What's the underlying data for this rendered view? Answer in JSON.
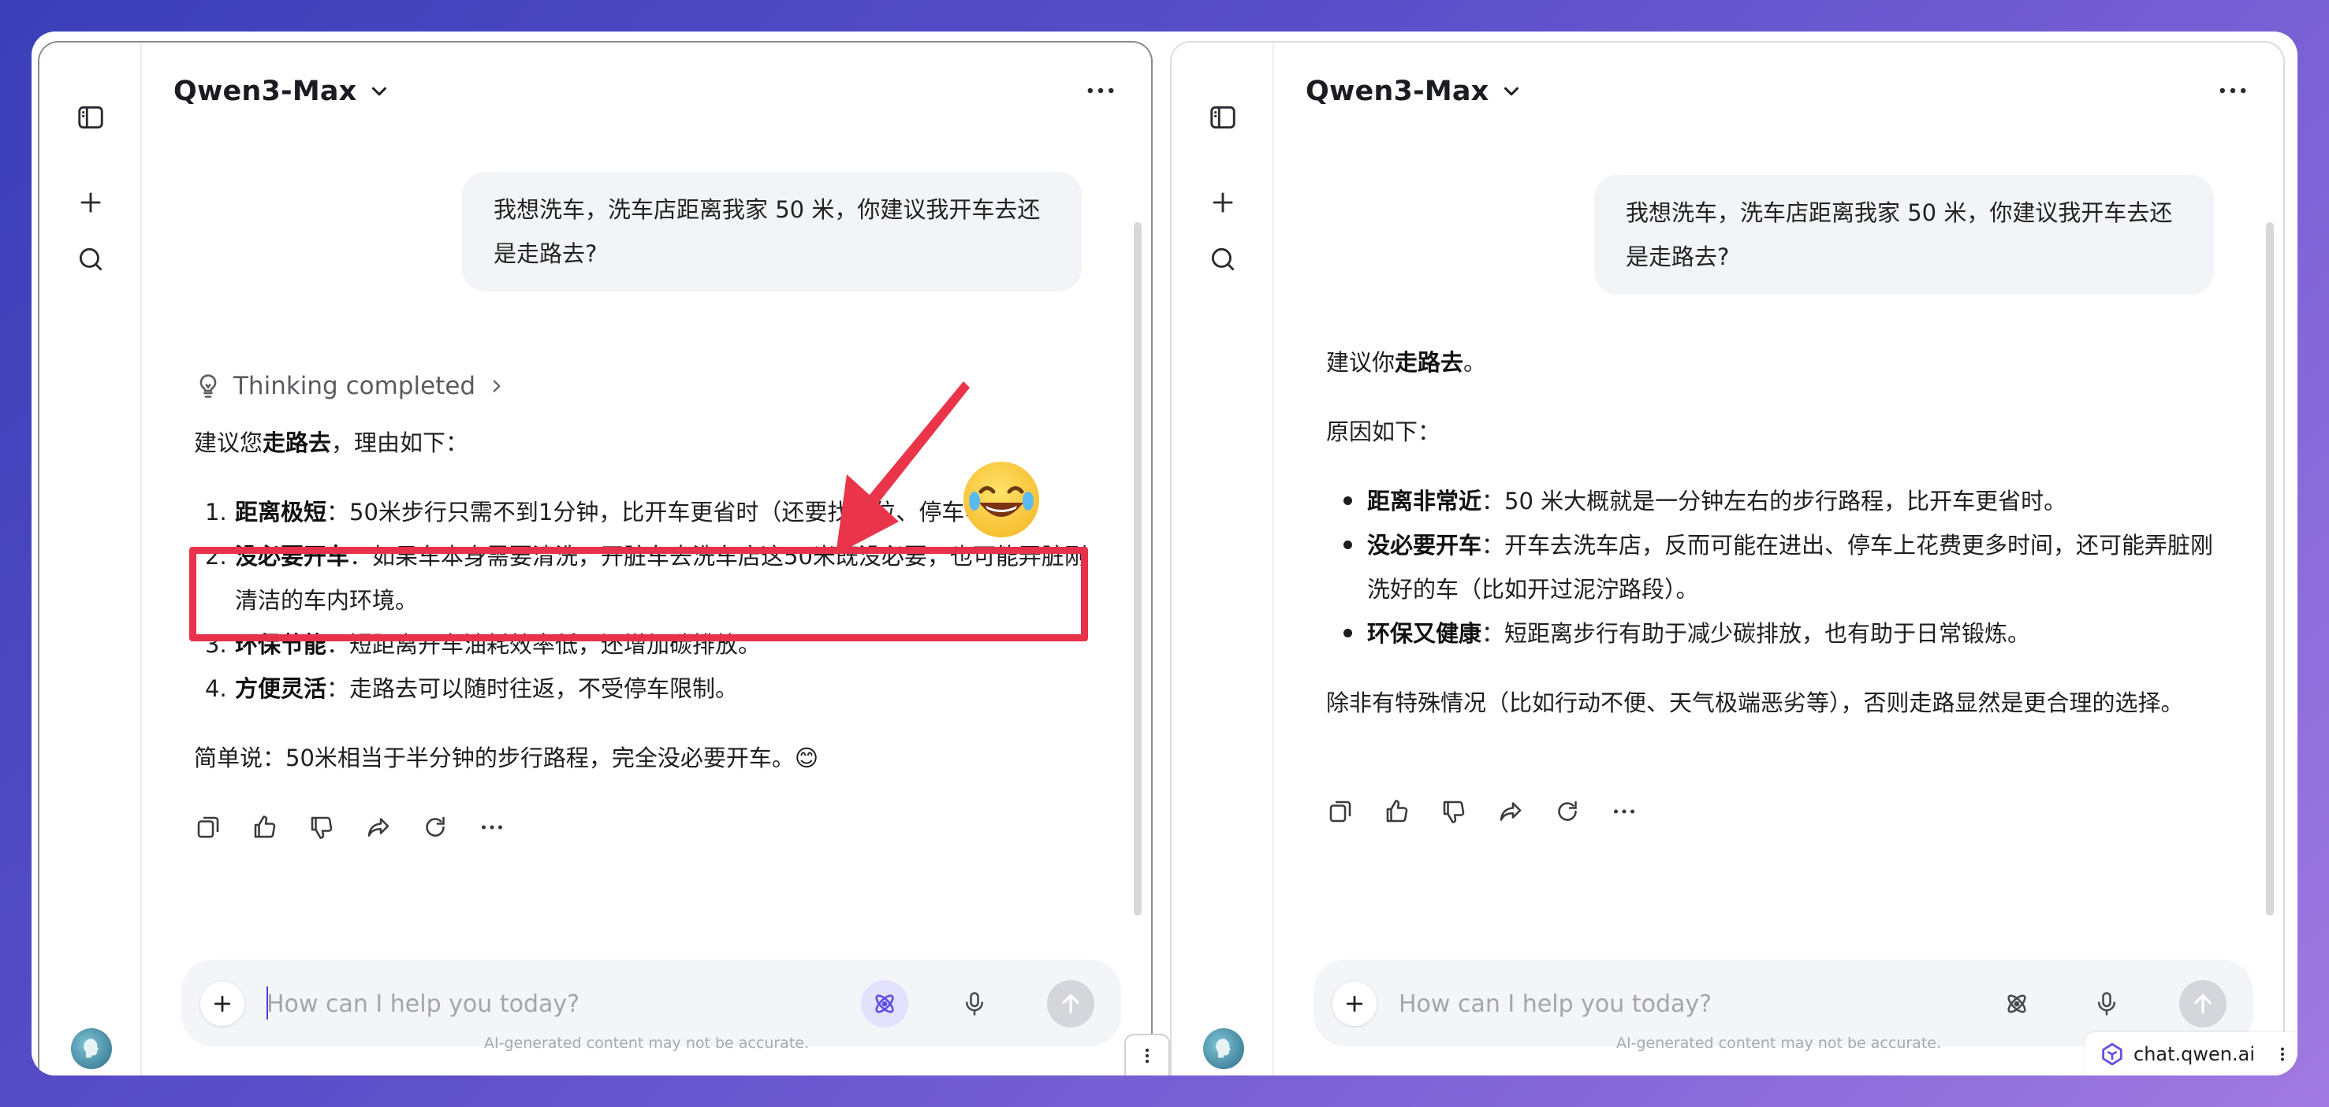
{
  "left_pane": {
    "model_name": "Qwen3-Max",
    "user_message": "我想洗车，洗车店距离我家 50 米，你建议我开车去还是走路去?",
    "thinking_label": "Thinking completed",
    "intro": {
      "prefix": "建议您",
      "bold": "走路去",
      "suffix": "，理由如下："
    },
    "items": [
      {
        "num": "1.",
        "bold": "距离极短",
        "text": "：50米步行只需不到1分钟，比开车更省时（还要找车位、停车等）。"
      },
      {
        "num": "2.",
        "bold": "没必要开车",
        "text": "：如果车本身需要清洗，开脏车去洗车店这50米既没必要，也可能弄脏刚清洁的车内环境。"
      },
      {
        "num": "3.",
        "bold": "环保节能",
        "text": "：短距离开车油耗效率低，还增加碳排放。"
      },
      {
        "num": "4.",
        "bold": "方便灵活",
        "text": "：走路去可以随时往返，不受停车限制。"
      }
    ],
    "summary": "简单说：50米相当于半分钟的步行路程，完全没必要开车。😊",
    "input_placeholder": "How can I help you today?",
    "disclaimer": "AI-generated content may not be accurate.",
    "emoji": "😂"
  },
  "right_pane": {
    "model_name": "Qwen3-Max",
    "user_message": "我想洗车，洗车店距离我家 50 米，你建议我开车去还是走路去?",
    "intro": {
      "prefix": "建议你",
      "bold": "走路去",
      "suffix": "。"
    },
    "reasons_heading": "原因如下：",
    "items": [
      {
        "bold": "距离非常近",
        "text": "：50 米大概就是一分钟左右的步行路程，比开车更省时。"
      },
      {
        "bold": "没必要开车",
        "text": "：开车去洗车店，反而可能在进出、停车上花费更多时间，还可能弄脏刚洗好的车（比如开过泥泞路段）。"
      },
      {
        "bold": "环保又健康",
        "text": "：短距离步行有助于减少碳排放，也有助于日常锻炼。"
      }
    ],
    "conclusion": "除非有特殊情况（比如行动不便、天气极端恶劣等），否则走路显然是更合理的选择。",
    "input_placeholder": "How can I help you today?",
    "disclaimer": "AI-generated content may not be accurate."
  },
  "watermark": {
    "text": "chat.qwen.ai"
  },
  "colors": {
    "accent": "#4a3fd8",
    "highlight": "#e8314a",
    "background_start": "#3b3fb8",
    "background_end": "#a07ae0"
  }
}
